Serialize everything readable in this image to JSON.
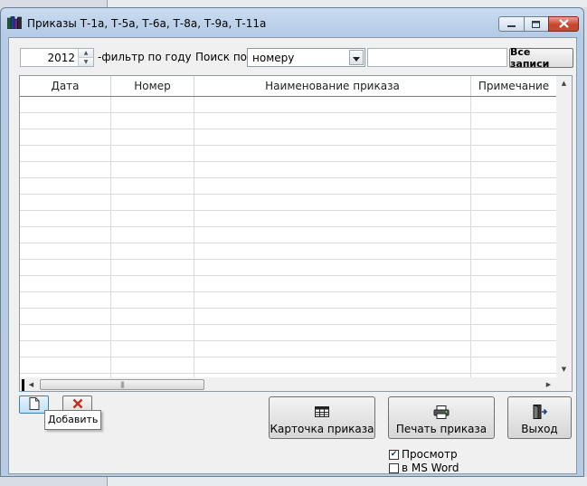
{
  "window": {
    "title": "Приказы Т-1а, Т-5а, Т-6а, Т-8а, Т-9а, Т-11а"
  },
  "filter": {
    "year": "2012",
    "year_label": "-фильтр по году",
    "search_label": "Поиск по",
    "search_by": "номеру",
    "search_value": "",
    "all_records": "Все записи"
  },
  "grid": {
    "columns": [
      "Дата",
      "Номер",
      "Наименование приказа",
      "Примечание"
    ],
    "rows": []
  },
  "buttons": {
    "add_tooltip": "Добавить",
    "card": "Карточка приказа",
    "print": "Печать приказа",
    "exit": "Выход"
  },
  "options": {
    "preview_label": "Просмотр",
    "preview_checked": true,
    "word_label": "в MS Word",
    "word_checked": false
  },
  "icons": [
    "app-books-icon",
    "minimize-icon",
    "maximize-icon",
    "close-icon",
    "spin-up-icon",
    "spin-down-icon",
    "dropdown-arrow-icon",
    "scroll-up-icon",
    "scroll-down-icon",
    "scroll-left-icon",
    "scroll-right-icon",
    "new-document-icon",
    "delete-x-icon",
    "table-card-icon",
    "printer-icon",
    "exit-door-icon"
  ],
  "colors": {
    "titlebar": "#c9dcf1",
    "close_button": "#c7462d",
    "client_bg": "#f0f0f0",
    "delete_x": "#c62a1e"
  }
}
